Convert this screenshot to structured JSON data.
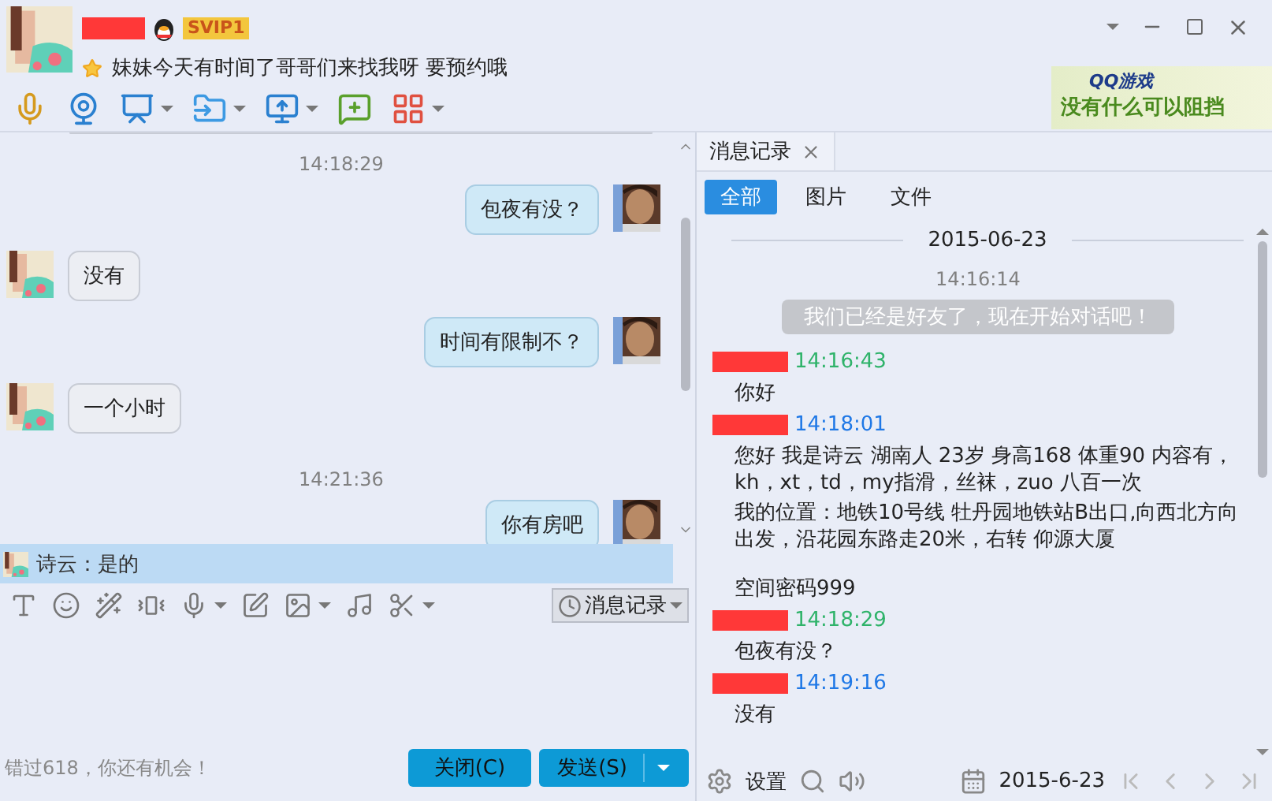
{
  "contact": {
    "badge": "SVIP1",
    "status": "妹妹今天有时间了哥哥们来找我呀 要预约哦"
  },
  "ad": {
    "logo": "QQ游戏",
    "slogan": "没有什么可以阻挡"
  },
  "chat": {
    "messages": [
      {
        "kind": "time",
        "text": "14:18:29"
      },
      {
        "kind": "out",
        "text": "包夜有没？"
      },
      {
        "kind": "in",
        "text": "没有"
      },
      {
        "kind": "out",
        "text": "时间有限制不？"
      },
      {
        "kind": "in",
        "text": "一个小时"
      },
      {
        "kind": "time",
        "text": "14:21:36"
      },
      {
        "kind": "out",
        "text": "你有房吧"
      }
    ],
    "quote": "诗云：是的"
  },
  "input_toolbar": {
    "history_button": "消息记录"
  },
  "footer": {
    "promo": "错过618，你还有机会！",
    "buttons": [
      "关闭(C)",
      "发送(S)"
    ]
  },
  "history": {
    "tab": "消息记录",
    "filters": [
      {
        "label": "全部",
        "selected": true
      },
      {
        "label": "图片",
        "selected": false
      },
      {
        "label": "文件",
        "selected": false
      }
    ],
    "date": "2015-06-23",
    "entries": [
      {
        "kind": "time",
        "text": "14:16:14"
      },
      {
        "kind": "system",
        "text": "我们已经是好友了，现在开始对话吧！"
      },
      {
        "kind": "header",
        "time": "14:16:43",
        "color": "#2fb36a"
      },
      {
        "kind": "text",
        "text": "你好"
      },
      {
        "kind": "header",
        "time": "14:18:01",
        "color": "#1f78e6"
      },
      {
        "kind": "text",
        "text": " 您好 我是诗云  湖南人 23岁 身高168 体重90 内容有，kh，xt，td，my指滑，丝袜，zuo  八百一次"
      },
      {
        "kind": "text",
        "text": "我的位置：地铁10号线 牡丹园地铁站B出口,向西北方向出发，沿花园东路走20米，右转 仰源大厦"
      },
      {
        "kind": "blank"
      },
      {
        "kind": "text",
        "text": "空间密码999"
      },
      {
        "kind": "header",
        "time": "14:18:29",
        "color": "#2fb36a"
      },
      {
        "kind": "text",
        "text": "包夜有没？"
      },
      {
        "kind": "header",
        "time": "14:19:16",
        "color": "#1f78e6"
      },
      {
        "kind": "text",
        "text": "没有"
      }
    ],
    "settings": "设置",
    "date_picker": "2015-6-23"
  }
}
